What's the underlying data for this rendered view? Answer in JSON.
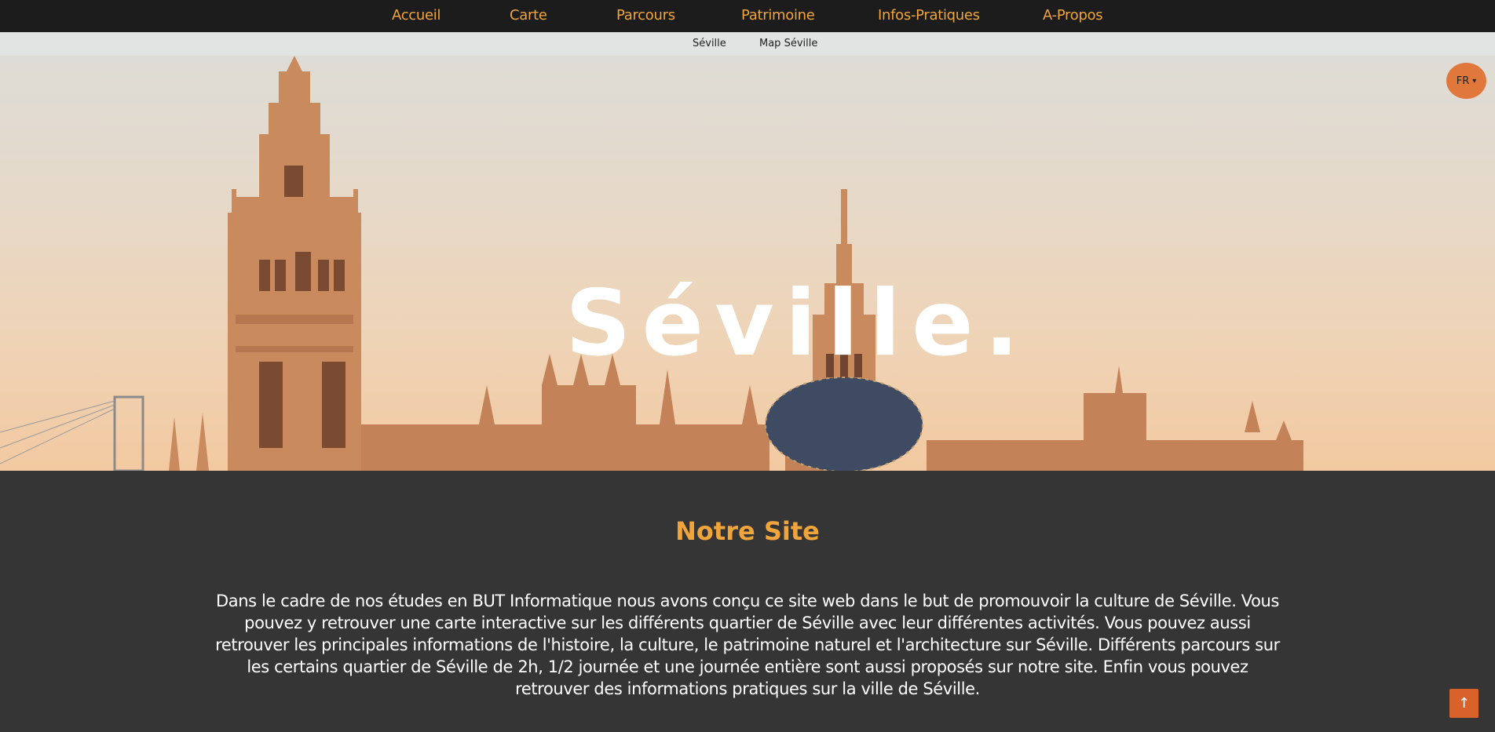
{
  "nav": {
    "items": [
      {
        "label": "Accueil"
      },
      {
        "label": "Carte"
      },
      {
        "label": "Parcours"
      },
      {
        "label": "Patrimoine"
      },
      {
        "label": "Infos-Pratiques"
      },
      {
        "label": "A-Propos"
      }
    ]
  },
  "subnav": {
    "items": [
      {
        "label": "Séville"
      },
      {
        "label": "Map Séville"
      }
    ]
  },
  "hero": {
    "title": "Séville."
  },
  "language": {
    "selected": "FR",
    "chevron": "▾"
  },
  "section": {
    "title": "Notre Site",
    "text": "Dans le cadre de nos études en BUT Informatique nous avons conçu ce site web dans le but de promouvoir la culture de Séville. Vous pouvez y retrouver une carte interactive sur les différents quartier de Séville avec leur différentes activités. Vous pouvez aussi retrouver les principales informations de l'histoire, la culture, le patrimoine naturel et l'architecture sur Séville. Différents parcours sur les certains quartier de Séville de 2h, 1/2 journée et une journée entière sont aussi proposés sur notre site. Enfin vous pouvez retrouver des informations pratiques sur la ville de Séville."
  },
  "scroll_top": {
    "icon": "arrow-up-icon",
    "glyph": "↑"
  },
  "colors": {
    "accent": "#f0a53c",
    "topnav_bg": "#1c1c1c",
    "subnav_bg": "#e2e4e3",
    "content_bg": "#353535",
    "lang_bg": "#e0773b",
    "scroll_btn_bg": "#d9622b"
  }
}
